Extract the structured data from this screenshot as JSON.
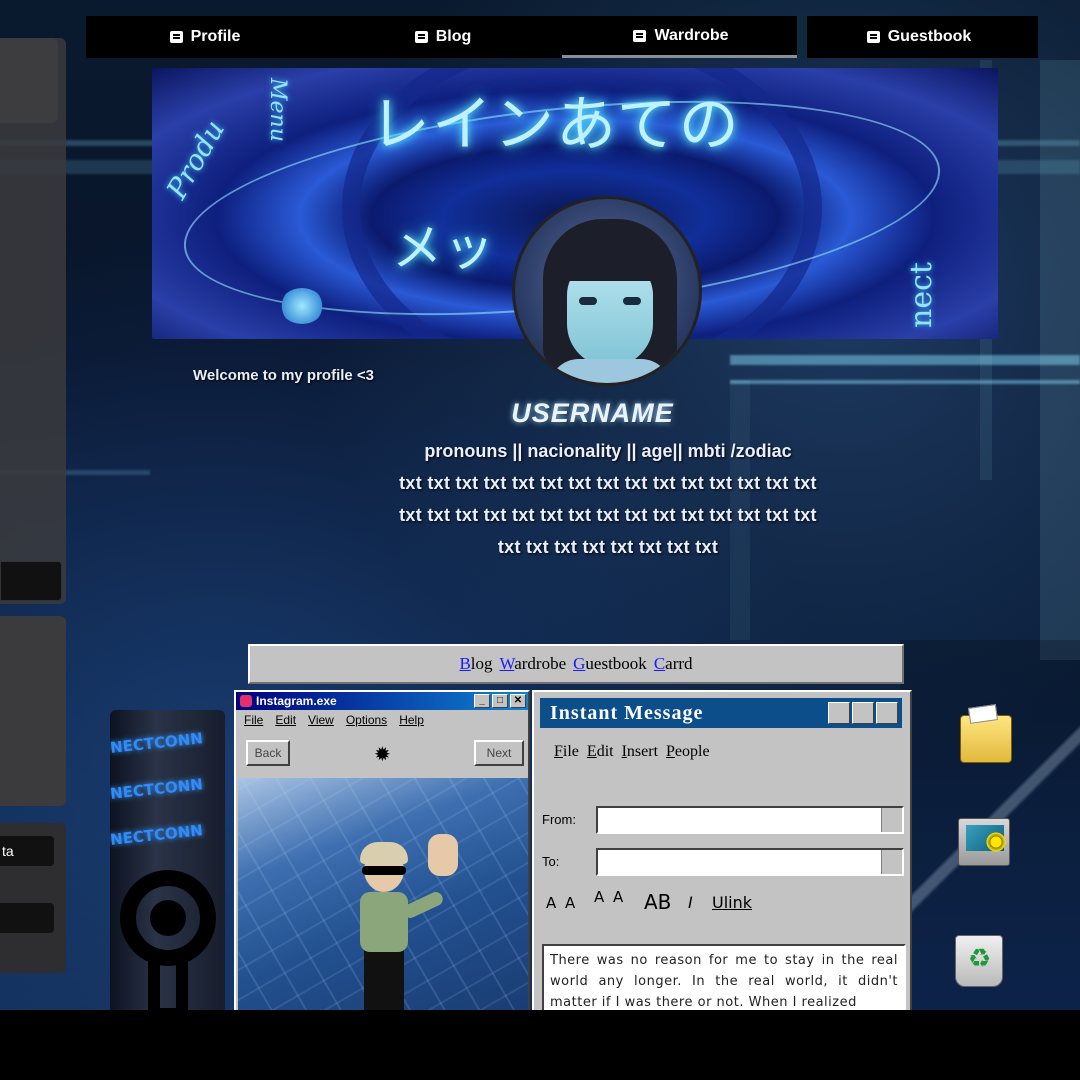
{
  "nav": {
    "tabs": [
      {
        "label": "Profile",
        "icon": "id-card-icon"
      },
      {
        "label": "Blog",
        "icon": "document-icon"
      },
      {
        "label": "Wardrobe",
        "icon": "table-icon"
      },
      {
        "label": "Guestbook",
        "icon": "message-icon"
      }
    ],
    "active": "Wardrobe"
  },
  "side": {
    "field_text": "ta"
  },
  "banner": {
    "jp_top": "レインあての",
    "jp_mid": "メッ",
    "side_left": "Produ",
    "side_left2": "Menu",
    "side_right": "nect"
  },
  "profile": {
    "welcome": "Welcome to my profile <3",
    "username": "USERNAME",
    "info": "pronouns || nacionality || age|| mbti /zodiac",
    "bio": [
      "txt txt txt txt txt txt txt txt txt txt txt txt txt txt txt",
      "txt txt txt txt txt txt txt txt txt txt txt txt txt txt txt",
      "txt txt txt txt txt txt txt txt"
    ]
  },
  "linkbar": {
    "links": [
      {
        "first": "B",
        "rest": "log"
      },
      {
        "first": "W",
        "rest": "ardrobe"
      },
      {
        "first": "G",
        "rest": "uestbook"
      },
      {
        "first": "C",
        "rest": "arrd"
      }
    ]
  },
  "pillar": {
    "word": "NECTCONN"
  },
  "insta": {
    "title": "Instagram.exe",
    "menu": [
      "File",
      "Edit",
      "View",
      "Options",
      "Help"
    ],
    "back": "Back",
    "next": "Next"
  },
  "im": {
    "title": "Instant Message",
    "menu": [
      {
        "first": "F",
        "rest": "ile"
      },
      {
        "first": "E",
        "rest": "dit"
      },
      {
        "first": "I",
        "rest": "nsert"
      },
      {
        "first": "P",
        "rest": "eople"
      }
    ],
    "from_label": "From:",
    "to_label": "To:",
    "fmt": [
      "A A",
      "A A",
      "AB",
      "I",
      "Ulink"
    ],
    "message": "There was no reason for me to stay in the real world any longer. In the real world, it didn't matter if I was there or not. When I realized"
  },
  "colors": {
    "accent": "#0b4e8a",
    "win_gray": "#c3c3c3",
    "glow": "#5ee3ff"
  }
}
